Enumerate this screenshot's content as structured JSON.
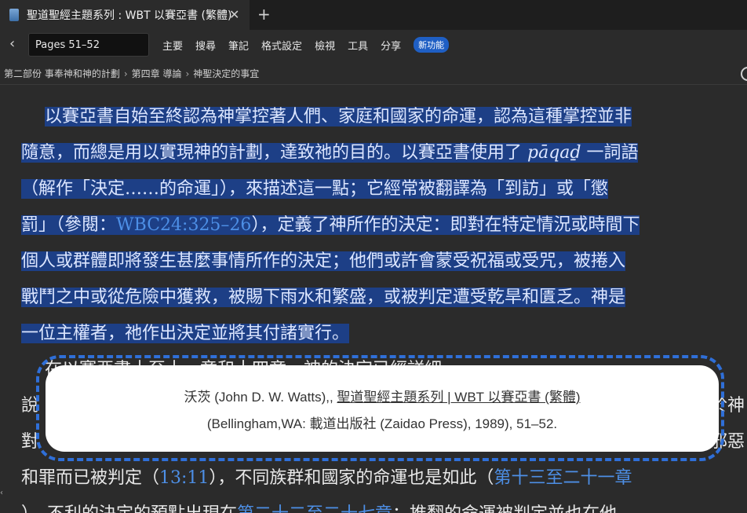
{
  "tab": {
    "title": "聖道聖經主題系列 : WBT 以賽亞書 (繁體)",
    "close": "✕",
    "new_tab": "+"
  },
  "toolbar": {
    "back_icon": "‹",
    "pages_value": "Pages 51–52",
    "menu": [
      "主要",
      "搜尋",
      "筆記",
      "格式設定",
      "檢視",
      "工具",
      "分享"
    ],
    "new_feature": "新功能"
  },
  "breadcrumb": [
    "第二部份 事奉神和神的計劃",
    "第四章 導論",
    "神聖決定的事宜"
  ],
  "breadcrumb_sep": "›",
  "content": {
    "p1_lines": [
      [
        "以賽亞書自始至終認為神掌控著人們、家庭和國家的命運，認為這種掌控並非"
      ],
      [
        "隨意，而總是用以實現神的計劃，達致祂的目的。以賽亞書使用了 ",
        "pāqaḏ",
        " 一詞語"
      ],
      [
        "（解作「決定……的命運」），來描述這一點；它經常被翻譯為「到訪」或「懲"
      ],
      [
        "罰」（參閱：",
        "WBC24:325–26",
        "），定義了神所作的決定：即對在特定情況或時間下"
      ],
      [
        "個人或群體即將發生甚麼事情所作的決定；他們或許會蒙受祝福或受咒，被捲入"
      ],
      [
        "戰鬥之中或從危險中獲救，被賜下雨水和繁盛，或被判定遭受乾旱和匱乏。神是"
      ],
      [
        "一位主權者，祂作出決定並將其付諸實行。"
      ]
    ],
    "p2_line1": "在以賽亞書十至十一章和十四章，神的決定已經詳細",
    "p2_line2_start": "說",
    "p2_line2_end": "於神",
    "p2_line3_start": "對",
    "p2_line3_end": "邪惡",
    "p2_line4": [
      "和罪而已被判定（",
      "13:11",
      "），不同族群和國家的命運也是如此（",
      "第十三至二十一章"
    ],
    "p2_line5": [
      "），不利的決定的預點出現在",
      "第二十二至二十七章",
      "；推翻的命運被判定並也在他"
    ]
  },
  "citation": {
    "author": "沃茨 (John D. W. Watts),, ",
    "title": "聖道聖經主題系列 | WBT 以賽亞書 (繁體)",
    "publisher": "(Bellingham,WA: 載道出版社 (Zaidao Press), 1989), 51–52."
  }
}
